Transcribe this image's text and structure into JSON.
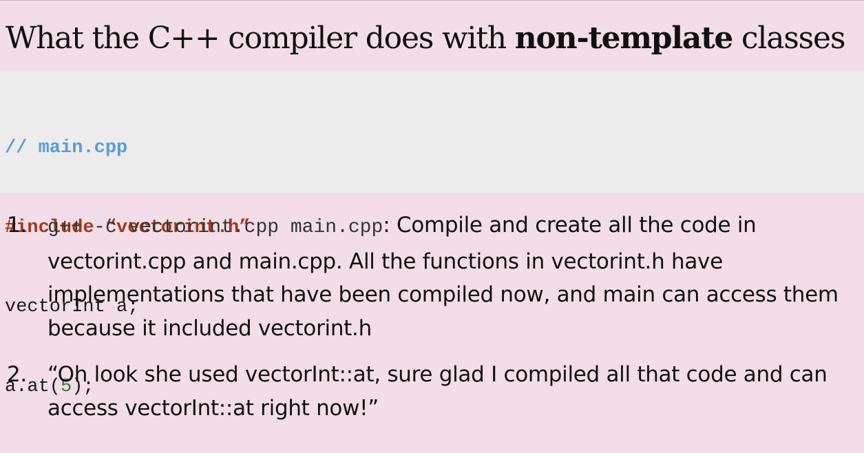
{
  "title": {
    "before": "What the C++ compiler does with ",
    "emphasis": "non-template",
    "after": " classes"
  },
  "code": {
    "comment": "// main.cpp",
    "include_keyword": "#include",
    "include_file": " “vectorint.h”",
    "declaration": "vectorInt a;",
    "call_prefix": "a.at(",
    "call_arg": "5",
    "call_suffix": ");"
  },
  "steps": [
    {
      "number": "1.",
      "command": "g++ -c vectorint.cpp main.cpp",
      "text": ": Compile and create all the code in vectorint.cpp and main.cpp. All the functions in vectorint.h have implementations that have been compiled now, and main can access them because it included vectorint.h"
    },
    {
      "number": "2.",
      "text": "“Oh look she used vectorInt::at, sure glad I compiled all that code and can access vectorInt::at right now!”"
    }
  ]
}
